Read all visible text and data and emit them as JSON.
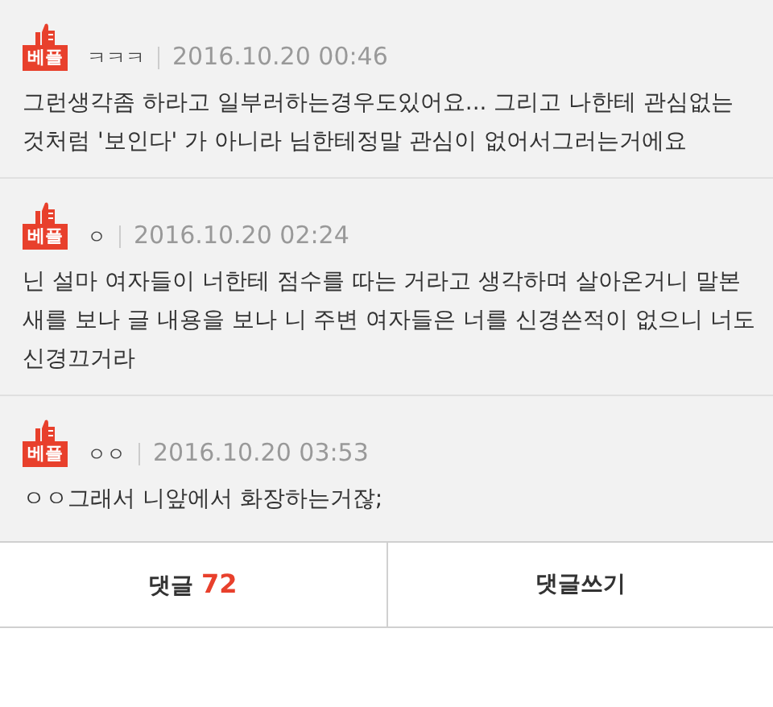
{
  "comments": [
    {
      "badge": "베플",
      "author": "ㅋㅋㅋ",
      "time": "2016.10.20 00:46",
      "text": "그런생각좀 하라고 일부러하는경우도있어요... 그리고 나한테 관심없는 것처럼 '보인다' 가 아니라 님한테정말 관심이 없어서그러는거에요"
    },
    {
      "badge": "베플",
      "author": "ㅇ",
      "time": "2016.10.20 02:24",
      "text": "닌 설마 여자들이 너한테 점수를 따는 거라고 생각하며 살아온거니 말본새를 보나 글 내용을 보나 니 주변 여자들은 너를 신경쓴적이 없으니 너도 신경끄거라"
    },
    {
      "badge": "베플",
      "author": "ㅇㅇ",
      "time": "2016.10.20 03:53",
      "text": "ㅇㅇ그래서 니앞에서 화장하는거잖;"
    }
  ],
  "footer": {
    "comments_label": "댓글",
    "comments_count": "72",
    "write_label": "댓글쓰기"
  }
}
